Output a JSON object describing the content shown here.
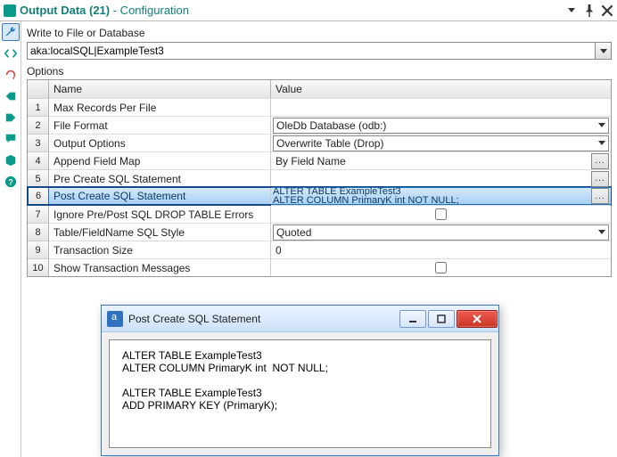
{
  "titlebar": {
    "tool_name": "Output Data (21)",
    "suffix": "  -  Configuration"
  },
  "connection": {
    "label": "Write to File or Database",
    "value": "aka:localSQL|ExampleTest3"
  },
  "options": {
    "label": "Options",
    "columns": {
      "name": "Name",
      "value": "Value"
    },
    "rows": [
      {
        "num": "1",
        "name": "Max Records Per File",
        "type": "text",
        "value": ""
      },
      {
        "num": "2",
        "name": "File Format",
        "type": "select",
        "value": "OleDb Database (odb:)"
      },
      {
        "num": "3",
        "name": "Output Options",
        "type": "select",
        "value": "Overwrite Table (Drop)"
      },
      {
        "num": "4",
        "name": "Append Field Map",
        "type": "browse",
        "value": "By Field Name"
      },
      {
        "num": "5",
        "name": "Pre Create SQL Statement",
        "type": "browse",
        "value": ""
      },
      {
        "num": "6",
        "name": "Post Create SQL Statement",
        "type": "browse",
        "value": "ALTER TABLE ExampleTest3\nALTER COLUMN PrimaryK int  NOT NULL;",
        "selected": true
      },
      {
        "num": "7",
        "name": "Ignore Pre/Post SQL DROP TABLE Errors",
        "type": "check",
        "value": "false"
      },
      {
        "num": "8",
        "name": "Table/FieldName SQL Style",
        "type": "select",
        "value": "Quoted"
      },
      {
        "num": "9",
        "name": "Transaction Size",
        "type": "text",
        "value": "0"
      },
      {
        "num": "10",
        "name": "Show Transaction Messages",
        "type": "check",
        "value": "false"
      }
    ]
  },
  "dialog": {
    "title": "Post Create SQL Statement",
    "text": "ALTER TABLE ExampleTest3\nALTER COLUMN PrimaryK int  NOT NULL;\n\nALTER TABLE ExampleTest3\nADD PRIMARY KEY (PrimaryK);"
  },
  "icons": {
    "toolbar": [
      "wrench",
      "code",
      "refresh",
      "tag-left",
      "tag-right",
      "comment",
      "cube",
      "help"
    ]
  }
}
